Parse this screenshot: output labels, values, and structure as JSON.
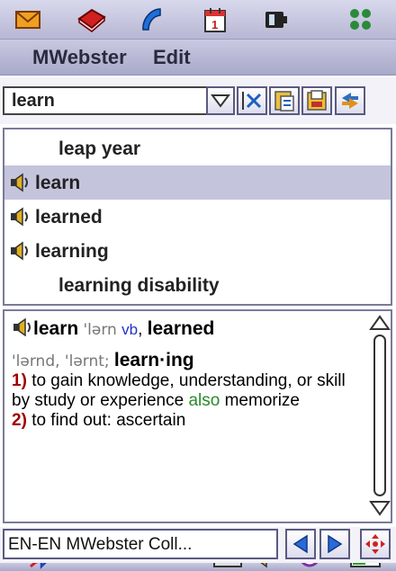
{
  "colors": {
    "menu_bg": "#b7b7d4",
    "selected_row": "#c4c4dc",
    "headword_num": "#a00000",
    "xref": "#2a8a2a",
    "pos": "#2233cc"
  },
  "appbar": {
    "icons": [
      "mail-icon",
      "books-icon",
      "phone-icon",
      "calendar-icon",
      "battery-app-icon",
      "apps-grid-icon"
    ]
  },
  "menu": {
    "items": [
      "MWebster",
      "Edit"
    ]
  },
  "search": {
    "value": "learn"
  },
  "word_list": {
    "items": [
      {
        "word": "leap year",
        "audio": false,
        "selected": false
      },
      {
        "word": "learn",
        "audio": true,
        "selected": true
      },
      {
        "word": "learned",
        "audio": true,
        "selected": false
      },
      {
        "word": "learning",
        "audio": true,
        "selected": false
      },
      {
        "word": "learning disability",
        "audio": false,
        "selected": false
      }
    ]
  },
  "definition": {
    "headword": "learn",
    "pron": "'lərn",
    "pos": "vb",
    "sep1": ",",
    "inflection1": "learned",
    "pron2": "'lərnd, 'lərnt;",
    "inflection2": "learn·ing",
    "sense1_num": "1)",
    "sense1_text": "to gain knowledge, understanding, or skill by study or experience",
    "sense1_xref": "also",
    "sense1_tail": "memorize",
    "sense2_num": "2)",
    "sense2_text": "to find out: ascertain"
  },
  "nav": {
    "dictionary_name": "EN-EN MWebster Coll..."
  },
  "status_icons": [
    "bluetooth-off-icon",
    "keyboard-icon",
    "volume-icon",
    "clock-icon",
    "battery-icon"
  ]
}
